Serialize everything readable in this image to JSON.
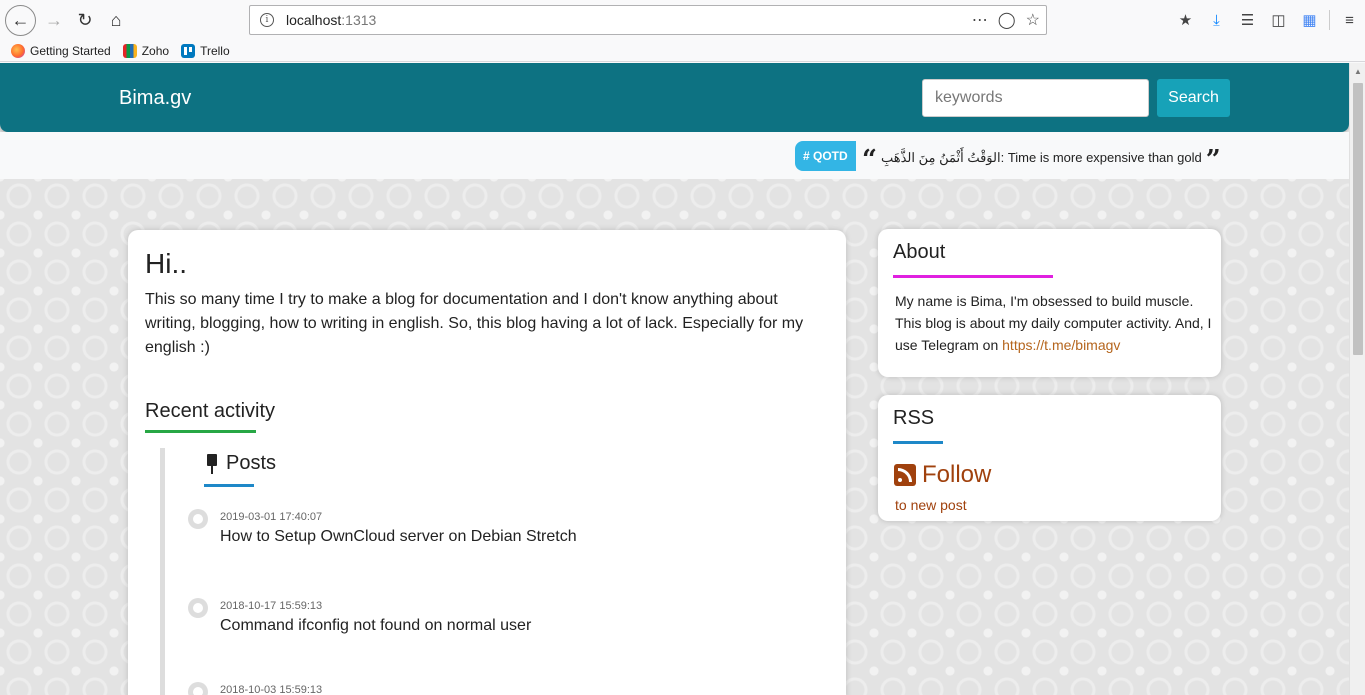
{
  "browser": {
    "url_host": "localhost",
    "url_port": ":1313",
    "bookmarks": [
      {
        "label": "Getting Started",
        "icon": "firefox-icon"
      },
      {
        "label": "Zoho",
        "icon": "zoho-icon"
      },
      {
        "label": "Trello",
        "icon": "trello-icon"
      }
    ]
  },
  "site": {
    "brand": "Bima.gv",
    "search_placeholder": "keywords",
    "search_label": "Search",
    "colors": {
      "navbar": "#0d7282",
      "search_button": "#17a2b8",
      "accent_link": "#a0410d"
    }
  },
  "qotd": {
    "badge": "# QOTD",
    "quote": "الوَقْتُ أَثْمَنُ مِنَ الذَّهَبِ: Time is more expensive than gold"
  },
  "main": {
    "heading": "Hi..",
    "intro": "This so many time I try to make a blog for documentation and I don't know anything about writing, blogging, how to writing in english. So, this blog having a lot of lack. Especially for my english :)",
    "recent_title": "Recent activity",
    "posts_title": "Posts",
    "posts": [
      {
        "date": "2019-03-01 17:40:07",
        "title": "How to Setup OwnCloud server on Debian Stretch"
      },
      {
        "date": "2018-10-17 15:59:13",
        "title": "Command ifconfig not found on normal user"
      },
      {
        "date": "2018-10-03 15:59:13",
        "title": ""
      }
    ]
  },
  "sidebar": {
    "about_title": "About",
    "about_text": "My name is Bima, I'm obsessed to build muscle. This blog is about my daily computer activity. And, I use Telegram on ",
    "about_link": "https://t.me/bimagv",
    "rss_title": "RSS",
    "follow_label": "Follow",
    "follow_sub": "to new post"
  }
}
